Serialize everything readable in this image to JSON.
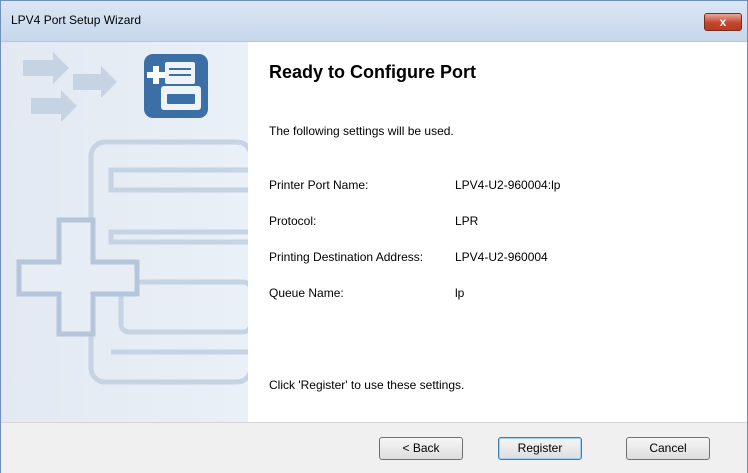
{
  "window": {
    "title": "LPV4 Port Setup Wizard",
    "close_label": "x"
  },
  "page": {
    "heading": "Ready to Configure Port",
    "subtitle": "The following settings will be used.",
    "settings": [
      {
        "label": "Printer Port Name:",
        "value": "LPV4-U2-960004:lp"
      },
      {
        "label": "Protocol:",
        "value": "LPR"
      },
      {
        "label": "Printing Destination Address:",
        "value": "LPV4-U2-960004"
      },
      {
        "label": "Queue Name:",
        "value": "lp"
      }
    ],
    "footer_note": "Click 'Register' to use these settings."
  },
  "buttons": {
    "back": "< Back",
    "register": "Register",
    "cancel": "Cancel"
  },
  "colors": {
    "banner_icon": "#3b6fa6",
    "banner_art": "#b7c7da",
    "accent_border": "#3c7fb1"
  },
  "icons": {
    "banner": "printer-port-icon",
    "close": "close-icon"
  }
}
